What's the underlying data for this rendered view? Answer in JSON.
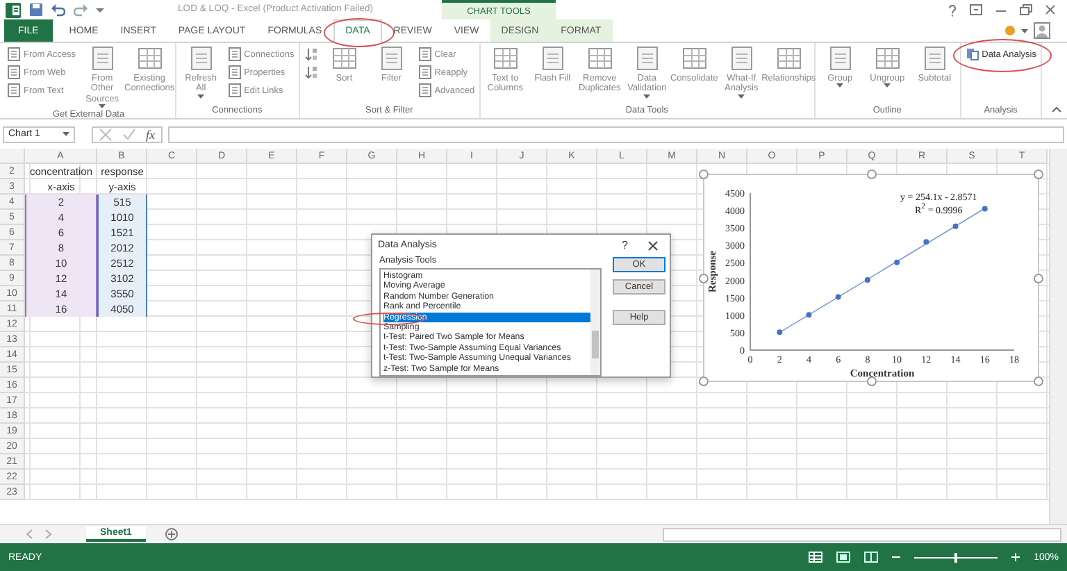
{
  "window": {
    "title": "LOD & LOQ - Excel (Product Activation Failed)",
    "context_label": "CHART TOOLS"
  },
  "tabs": [
    {
      "label": "FILE",
      "kind": "file",
      "selected": false,
      "circled": false
    },
    {
      "label": "HOME",
      "kind": "plain",
      "selected": false,
      "circled": false
    },
    {
      "label": "INSERT",
      "kind": "plain",
      "selected": false,
      "circled": false
    },
    {
      "label": "PAGE LAYOUT",
      "kind": "plain",
      "selected": false,
      "circled": false
    },
    {
      "label": "FORMULAS",
      "kind": "plain",
      "selected": false,
      "circled": false
    },
    {
      "label": "DATA",
      "kind": "plain",
      "selected": true,
      "circled": true
    },
    {
      "label": "REVIEW",
      "kind": "plain",
      "selected": false,
      "circled": false
    },
    {
      "label": "VIEW",
      "kind": "plain",
      "selected": false,
      "circled": false
    },
    {
      "label": "DESIGN",
      "kind": "context",
      "selected": false,
      "circled": false
    },
    {
      "label": "FORMAT",
      "kind": "context",
      "selected": false,
      "circled": false
    }
  ],
  "ribbon": [
    {
      "label": "Get External Data",
      "items": [
        {
          "kind": "stack",
          "items": [
            {
              "kind": "small",
              "label": "From Access"
            },
            {
              "kind": "small",
              "label": "From Web"
            },
            {
              "kind": "small",
              "label": "From Text"
            }
          ]
        },
        {
          "kind": "large",
          "label": "From Other Sources",
          "dropdown": true
        },
        {
          "kind": "large",
          "label": "Existing Connections",
          "dropdown": false
        }
      ]
    },
    {
      "label": "Connections",
      "items": [
        {
          "kind": "large",
          "label": "Refresh All",
          "dropdown": true
        },
        {
          "kind": "stack",
          "items": [
            {
              "kind": "small",
              "label": "Connections"
            },
            {
              "kind": "small",
              "label": "Properties"
            },
            {
              "kind": "small",
              "label": "Edit Links"
            }
          ]
        }
      ]
    },
    {
      "label": "Sort & Filter",
      "items": [
        {
          "kind": "stack",
          "items": [
            {
              "kind": "icon"
            },
            {
              "kind": "icon"
            }
          ]
        },
        {
          "kind": "large",
          "label": "Sort",
          "dropdown": false
        },
        {
          "kind": "large",
          "label": "Filter",
          "dropdown": false
        },
        {
          "kind": "stack",
          "items": [
            {
              "kind": "small",
              "label": "Clear"
            },
            {
              "kind": "small",
              "label": "Reapply"
            },
            {
              "kind": "small",
              "label": "Advanced"
            }
          ]
        }
      ]
    },
    {
      "label": "Data Tools",
      "items": [
        {
          "kind": "large",
          "label": "Text to Columns",
          "dropdown": false
        },
        {
          "kind": "large",
          "label": "Flash Fill",
          "dropdown": false
        },
        {
          "kind": "large",
          "label": "Remove Duplicates",
          "dropdown": false
        },
        {
          "kind": "large",
          "label": "Data Validation",
          "dropdown": true
        },
        {
          "kind": "large",
          "label": "Consolidate",
          "dropdown": false
        },
        {
          "kind": "large",
          "label": "What-If Analysis",
          "dropdown": true
        },
        {
          "kind": "large",
          "label": "Relationships",
          "dropdown": false
        }
      ]
    },
    {
      "label": "Outline",
      "items": [
        {
          "kind": "large",
          "label": "Group",
          "dropdown": true
        },
        {
          "kind": "large",
          "label": "Ungroup",
          "dropdown": true
        },
        {
          "kind": "large",
          "label": "Subtotal",
          "dropdown": false
        }
      ]
    },
    {
      "label": "Analysis",
      "items": [
        {
          "kind": "stack",
          "items": [
            {
              "kind": "small",
              "label": "Data Analysis",
              "circled": true
            }
          ]
        }
      ]
    }
  ],
  "formula_bar": {
    "name_box": "Chart 1",
    "function_label": "fx"
  },
  "sheet": {
    "columns": [
      "A",
      "B",
      "C",
      "D",
      "E",
      "F",
      "G",
      "H",
      "I",
      "J",
      "K",
      "L",
      "M",
      "N",
      "O",
      "P",
      "Q",
      "R",
      "S",
      "T"
    ],
    "rows": [
      {
        "number": "2",
        "highlighted": false,
        "cells": [
          "concentration",
          "response"
        ]
      },
      {
        "number": "3",
        "highlighted": false,
        "cells": [
          "x-axis",
          "y-axis"
        ]
      },
      {
        "number": "4",
        "highlighted": true,
        "cells": [
          "2",
          "515"
        ]
      },
      {
        "number": "5",
        "highlighted": true,
        "cells": [
          "4",
          "1010"
        ]
      },
      {
        "number": "6",
        "highlighted": true,
        "cells": [
          "6",
          "1521"
        ]
      },
      {
        "number": "7",
        "highlighted": true,
        "cells": [
          "8",
          "2012"
        ]
      },
      {
        "number": "8",
        "highlighted": true,
        "cells": [
          "10",
          "2512"
        ]
      },
      {
        "number": "9",
        "highlighted": true,
        "cells": [
          "12",
          "3102"
        ]
      },
      {
        "number": "10",
        "highlighted": true,
        "cells": [
          "14",
          "3550"
        ]
      },
      {
        "number": "11",
        "highlighted": true,
        "cells": [
          "16",
          "4050"
        ]
      },
      {
        "number": "12",
        "highlighted": false,
        "cells": []
      },
      {
        "number": "13",
        "highlighted": false,
        "cells": []
      },
      {
        "number": "14",
        "highlighted": false,
        "cells": []
      },
      {
        "number": "15",
        "highlighted": false,
        "cells": []
      },
      {
        "number": "16",
        "highlighted": false,
        "cells": []
      },
      {
        "number": "17",
        "highlighted": false,
        "cells": []
      },
      {
        "number": "18",
        "highlighted": false,
        "cells": []
      },
      {
        "number": "19",
        "highlighted": false,
        "cells": []
      },
      {
        "number": "20",
        "highlighted": false,
        "cells": []
      },
      {
        "number": "21",
        "highlighted": false,
        "cells": []
      },
      {
        "number": "22",
        "highlighted": false,
        "cells": []
      },
      {
        "number": "23",
        "highlighted": false,
        "cells": []
      }
    ]
  },
  "chart": {
    "chart_data": {
      "type": "scatter",
      "xlabel": "Concentration",
      "ylabel": "Response",
      "x": [
        2,
        4,
        6,
        8,
        10,
        12,
        14,
        16
      ],
      "series": [
        {
          "color": "#4472c4",
          "values": [
            515,
            1010,
            1521,
            2012,
            2512,
            3102,
            3550,
            4050
          ]
        }
      ],
      "xlim": [
        0,
        18
      ],
      "ylim": [
        0,
        4500
      ],
      "xticks": [
        0,
        2,
        4,
        6,
        8,
        10,
        12,
        14,
        16,
        18
      ],
      "yticks": [
        0,
        500,
        1000,
        1500,
        2000,
        2500,
        3000,
        3500,
        4000,
        4500
      ],
      "annotations": [
        "y = 254.1x - 2.8571",
        "R$^{2}$ = 0.9996"
      ]
    }
  },
  "dialog": {
    "title": "Data Analysis",
    "help": "?",
    "list_label": "Analysis Tools",
    "items": [
      {
        "label": "Histogram",
        "selected": false,
        "circled": false
      },
      {
        "label": "Moving Average",
        "selected": false,
        "circled": false
      },
      {
        "label": "Random Number Generation",
        "selected": false,
        "circled": false
      },
      {
        "label": "Rank and Percentile",
        "selected": false,
        "circled": false
      },
      {
        "label": "Regression",
        "selected": true,
        "circled": true
      },
      {
        "label": "Sampling",
        "selected": false,
        "circled": false
      },
      {
        "label": "t-Test: Paired Two Sample for Means",
        "selected": false,
        "circled": false
      },
      {
        "label": "t-Test: Two-Sample Assuming Equal Variances",
        "selected": false,
        "circled": false
      },
      {
        "label": "t-Test: Two-Sample Assuming Unequal Variances",
        "selected": false,
        "circled": false
      },
      {
        "label": "z-Test: Two Sample for Means",
        "selected": false,
        "circled": false
      }
    ],
    "buttons": [
      {
        "label": "OK",
        "default": true
      },
      {
        "label": "Cancel",
        "default": false
      },
      {
        "label": "Help",
        "default": false
      }
    ]
  },
  "sheet_tabs": [
    {
      "label": "Sheet1",
      "selected": true
    }
  ],
  "status_bar": {
    "mode": "READY",
    "zoom": "100%",
    "zoom_slider": {
      "level": 0.5
    }
  }
}
